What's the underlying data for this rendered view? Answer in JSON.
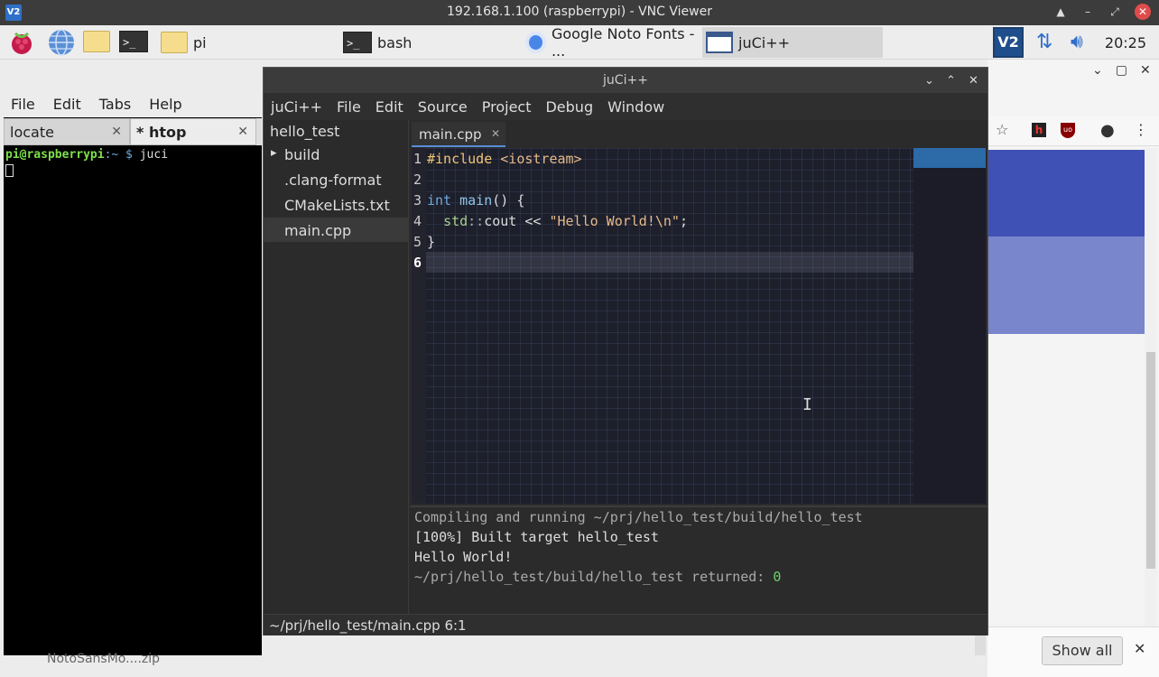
{
  "vnc": {
    "title": "192.168.1.100 (raspberrypi) - VNC Viewer",
    "logo": "V2",
    "controls": [
      "▲",
      "–",
      "⤢",
      "✕"
    ]
  },
  "taskbar": {
    "tasks": [
      {
        "label": "pi",
        "icon": "folder-icon"
      },
      {
        "label": "bash",
        "icon": "terminal-icon"
      },
      {
        "label": "Google Noto Fonts - ...",
        "icon": "chromium-icon"
      },
      {
        "label": "juCi++",
        "icon": "juci-icon"
      }
    ],
    "tray_logo": "V2",
    "clock": "20:25"
  },
  "terminal": {
    "menu": [
      "File",
      "Edit",
      "Tabs",
      "Help"
    ],
    "tabs": [
      {
        "label": "locate",
        "close": "✕"
      },
      {
        "label": "* htop",
        "close": "✕"
      }
    ],
    "prompt_user": "pi@raspberrypi",
    "prompt_rest": ":~ $ ",
    "command": "juci"
  },
  "juci": {
    "title": "juCi++",
    "menu": [
      "juCi++",
      "File",
      "Edit",
      "Source",
      "Project",
      "Debug",
      "Window"
    ],
    "tree": {
      "root": "hello_test",
      "items": [
        "build",
        ".clang-format",
        "CMakeLists.txt",
        "main.cpp"
      ],
      "expander": "▸"
    },
    "tab": {
      "label": "main.cpp",
      "close": "✕"
    },
    "line_numbers": [
      "1",
      "2",
      "3",
      "4",
      "5",
      "6"
    ],
    "code": {
      "l1_inc": "#include ",
      "l1_hdr": "<iostream>",
      "l3_kw": "int",
      "l3_fn": " main",
      "l3_rest": "() {",
      "l4_indent": "  ",
      "l4_ns": "std",
      "l4_sep": "::",
      "l4_id": "cout",
      "l4_op": " << ",
      "l4_str": "\"Hello World!\\n\"",
      "l4_end": ";",
      "l5": "}"
    },
    "output": {
      "line1": "Compiling and running ~/prj/hello_test/build/hello_test",
      "line2": "[100%] Built target hello_test",
      "line3": "Hello World!",
      "line4_text": "~/prj/hello_test/build/hello_test returned: ",
      "line4_code": "0"
    },
    "status": "~/prj/hello_test/main.cpp 6:1"
  },
  "browser": {
    "download_name": "NotoSansMo....zip",
    "show_all": "Show all",
    "close": "✕"
  }
}
